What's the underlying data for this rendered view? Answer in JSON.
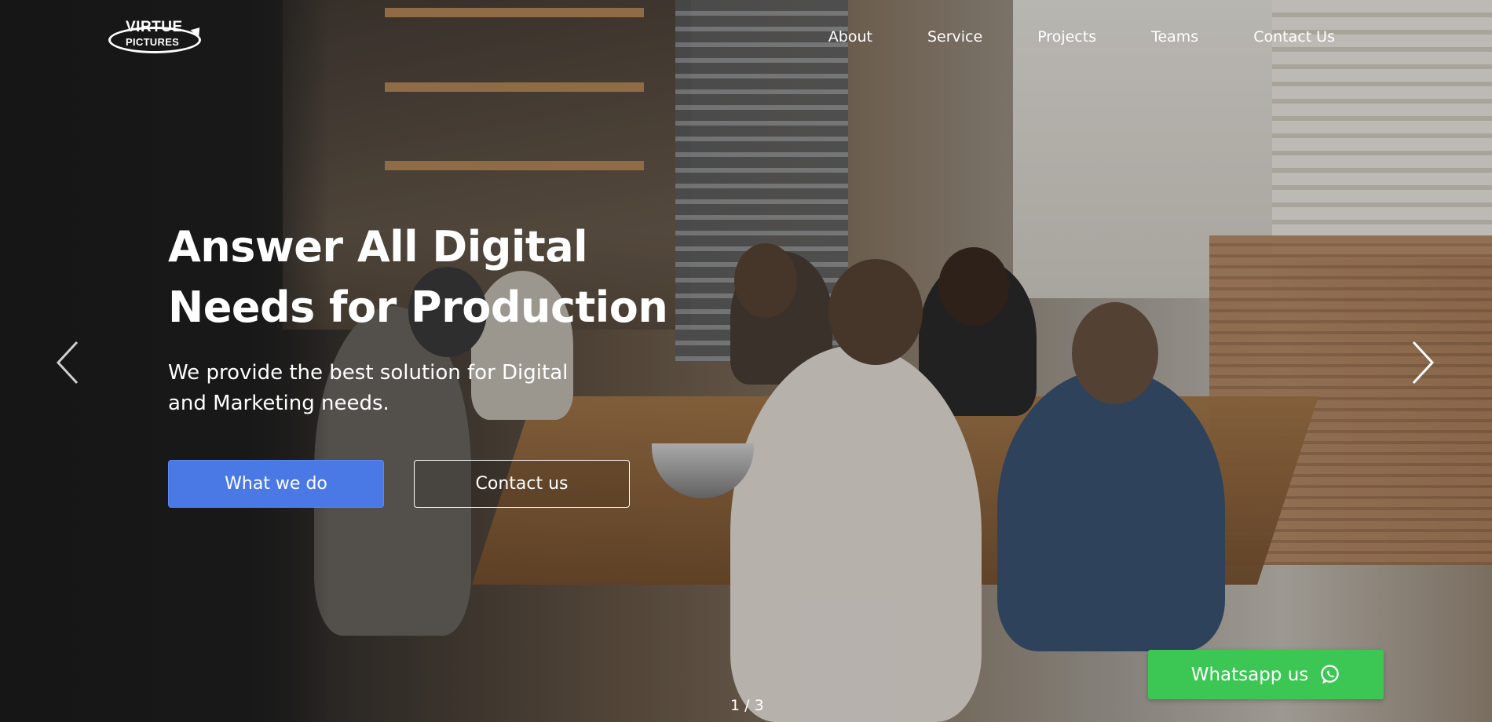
{
  "brand": {
    "logo_line1": "VIRTUE",
    "logo_line2": "PICTURES"
  },
  "nav": {
    "items": [
      {
        "label": "About"
      },
      {
        "label": "Service"
      },
      {
        "label": "Projects"
      },
      {
        "label": "Teams"
      },
      {
        "label": "Contact Us"
      }
    ]
  },
  "hero": {
    "title_line1": "Answer All Digital",
    "title_line2": "Needs for Production",
    "subtitle_line1": "We provide the best solution for Digital",
    "subtitle_line2": "and Marketing needs.",
    "primary_button": "What we do",
    "secondary_button": "Contact us"
  },
  "slider": {
    "prev_icon": "chevron-left-icon",
    "next_icon": "chevron-right-icon",
    "pager": "1 / 3"
  },
  "whatsapp": {
    "label": "Whatsapp us",
    "icon": "whatsapp-icon"
  },
  "colors": {
    "primary": "#4a79e6",
    "whatsapp": "#3cc754",
    "text": "#ffffff"
  }
}
